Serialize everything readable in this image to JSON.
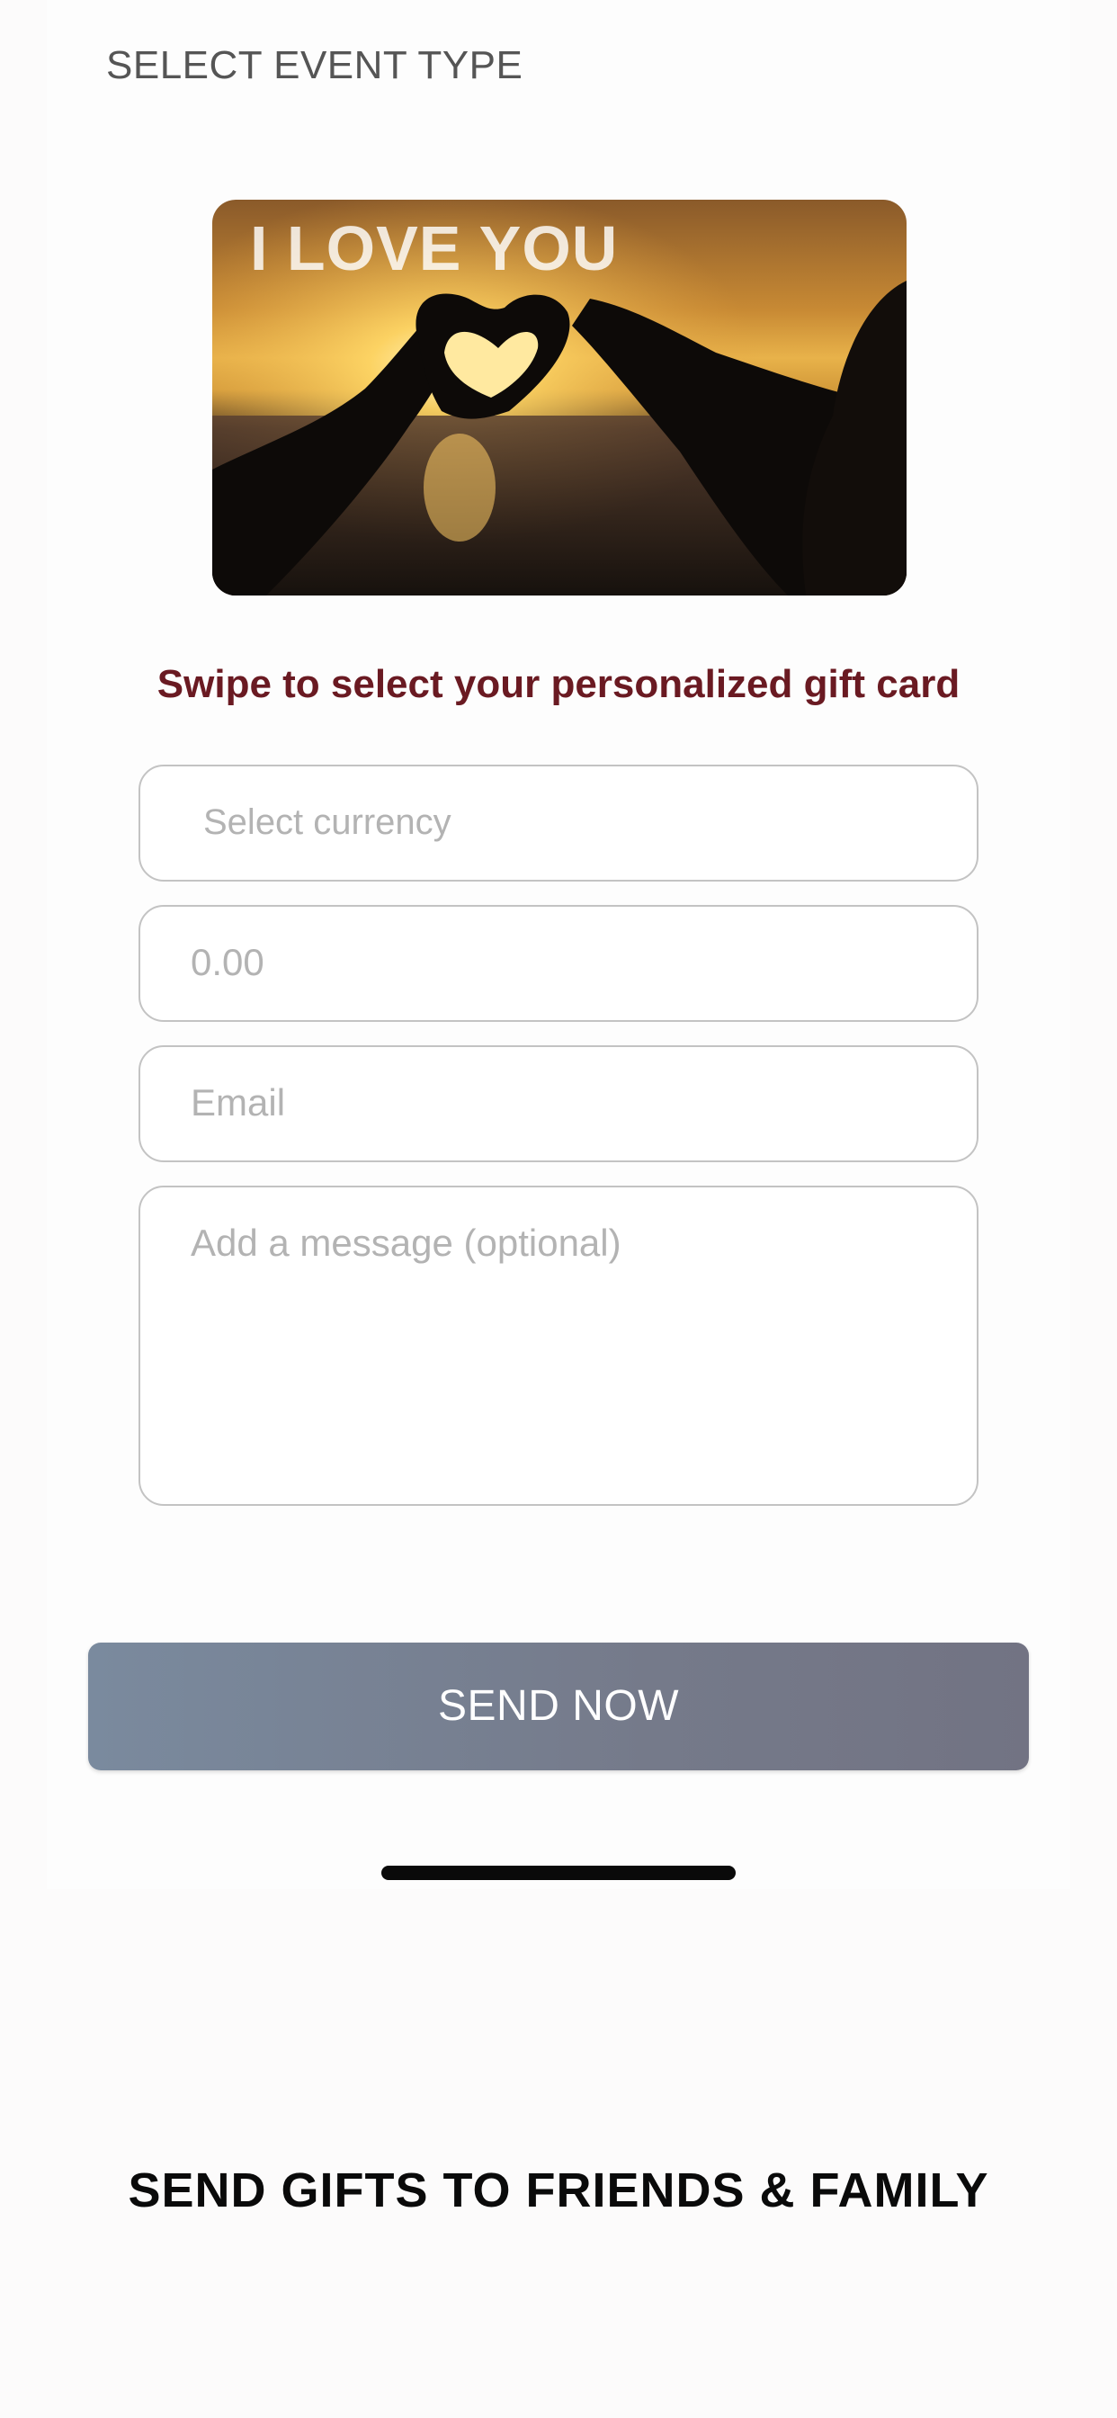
{
  "header": {
    "event_type_label": "SELECT EVENT TYPE"
  },
  "gift_card": {
    "caption": "I LOVE YOU"
  },
  "swipe_hint": "Swipe to select your personalized gift card",
  "form": {
    "currency_placeholder": "Select currency",
    "amount_placeholder": "0.00",
    "email_placeholder": "Email",
    "message_placeholder": "Add a message (optional)"
  },
  "send_button_label": "SEND NOW",
  "footer_title": "SEND GIFTS TO FRIENDS & FAMILY",
  "colors": {
    "swipe_hint": "#6a1a22",
    "send_button_start": "#7a8a9e",
    "send_button_end": "#727383"
  }
}
